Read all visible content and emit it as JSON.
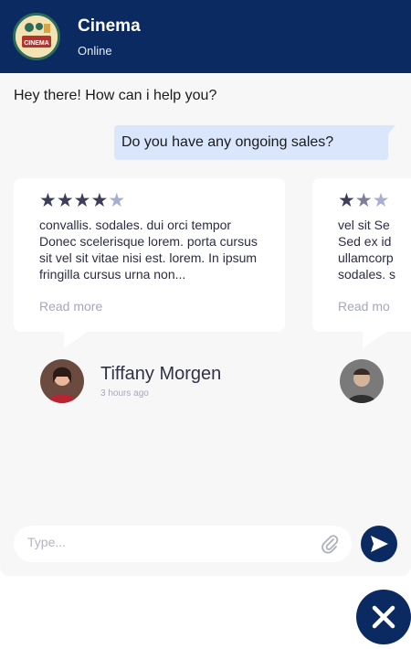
{
  "header": {
    "title": "Cinema",
    "status": "Online",
    "logo_text": "CINEMA"
  },
  "messages": {
    "bot": "Hey there! How can i help you?",
    "user": "Do you have any ongoing sales?"
  },
  "reviews": [
    {
      "rating": 4,
      "text": "convallis. sodales. dui orci tempor Donec scelerisque lorem. porta cursus sit vel sit vitae nisi est. lorem. In ipsum fringilla cursus urna non...",
      "read_more": "Read more",
      "name": "Tiffany Morgen",
      "time": "3 hours ago"
    },
    {
      "rating": 2,
      "text": "vel sit Se Sed ex id ullamcorp sodales. s",
      "read_more": "Read mo"
    }
  ],
  "composer": {
    "placeholder": "Type..."
  },
  "colors": {
    "brand": "#0c2a62",
    "user_bubble": "#d9e6fb",
    "star_on": "#3d3e5a",
    "star_off": "#a8aece"
  },
  "icons": {
    "attach": "paperclip-icon",
    "send": "send-icon",
    "close": "close-icon"
  }
}
